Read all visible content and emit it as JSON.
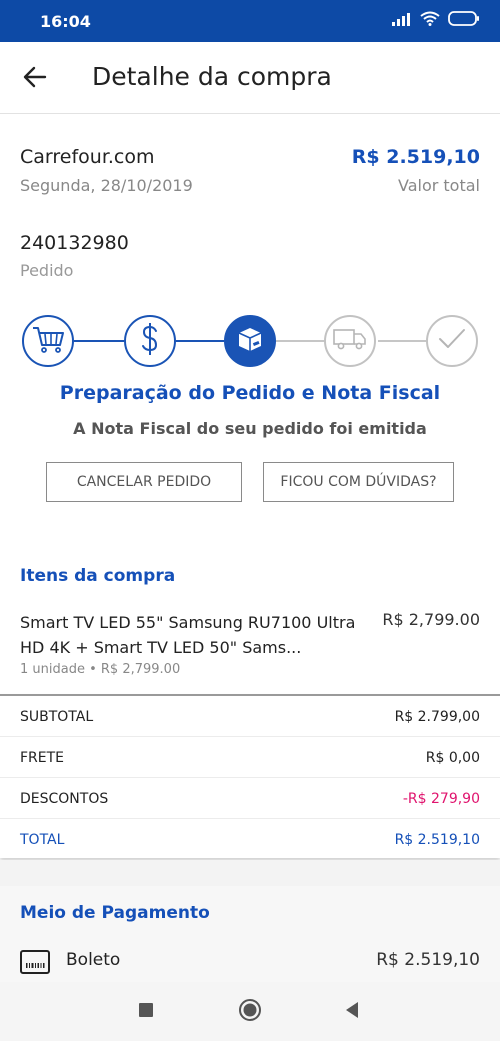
{
  "status_bar": {
    "time": "16:04"
  },
  "header": {
    "title": "Detalhe da compra"
  },
  "order": {
    "store": "Carrefour.com",
    "date": "Segunda, 28/10/2019",
    "total_value": "R$ 2.519,10",
    "total_label": "Valor total",
    "number": "240132980",
    "number_label": "Pedido"
  },
  "tracker": {
    "steps": [
      {
        "icon": "cart-icon",
        "state": "done"
      },
      {
        "icon": "dollar-icon",
        "state": "done"
      },
      {
        "icon": "box-icon",
        "state": "current"
      },
      {
        "icon": "truck-icon",
        "state": "todo"
      },
      {
        "icon": "check-icon",
        "state": "todo"
      }
    ],
    "stage_title": "Preparação do Pedido e Nota Fiscal",
    "stage_desc": "A Nota Fiscal do seu pedido foi emitida"
  },
  "actions": {
    "cancel_label": "CANCELAR PEDIDO",
    "help_label": "FICOU COM DÚVIDAS?"
  },
  "items": {
    "section_title": "Itens da compra",
    "list": [
      {
        "name": "Smart TV LED 55\" Samsung RU7100 Ultra HD 4K + Smart TV LED 50\" Sams...",
        "price": "R$ 2,799.00",
        "detail": "1 unidade • R$ 2,799.00"
      }
    ]
  },
  "summary": {
    "rows": [
      {
        "label": "SUBTOTAL",
        "value": "R$ 2.799,00"
      },
      {
        "label": "FRETE",
        "value": "R$ 0,00"
      },
      {
        "label": "DESCONTOS",
        "value": "-R$ 279,90"
      },
      {
        "label": "TOTAL",
        "value": "R$ 2.519,10"
      }
    ]
  },
  "payment": {
    "section_title": "Meio de Pagamento",
    "method": "Boleto",
    "value": "R$ 2.519,10",
    "icon": "barcode-icon"
  },
  "colors": {
    "primary": "#0d4aa6",
    "accent_blue": "#1550b8",
    "discount": "#e0146e"
  }
}
